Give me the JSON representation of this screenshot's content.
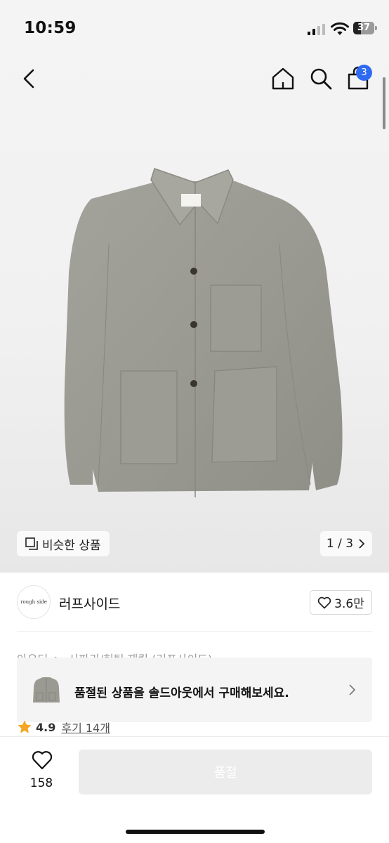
{
  "status_bar": {
    "time": "10:59",
    "battery": "37"
  },
  "nav": {
    "cart_count": "3"
  },
  "gallery": {
    "similar_label": "비슷한 상품",
    "pager": "1 / 3"
  },
  "brand": {
    "name": "러프사이드",
    "logo_text": "rough side",
    "likes": "3.6만"
  },
  "breadcrumb": [
    "아우터",
    "사파리/헌팅 재킷 (러프사이드)"
  ],
  "soldout_banner": {
    "message": "품절된 상품을 솔드아웃에서 구매해보세요."
  },
  "rating": {
    "score": "4.9",
    "reviews": "후기 14개"
  },
  "bottom": {
    "wish_count": "158",
    "buy_label": "품절"
  },
  "colors": {
    "accent_badge": "#2f6bf2",
    "star": "#f5a623",
    "disabled_button": "#ececec"
  }
}
